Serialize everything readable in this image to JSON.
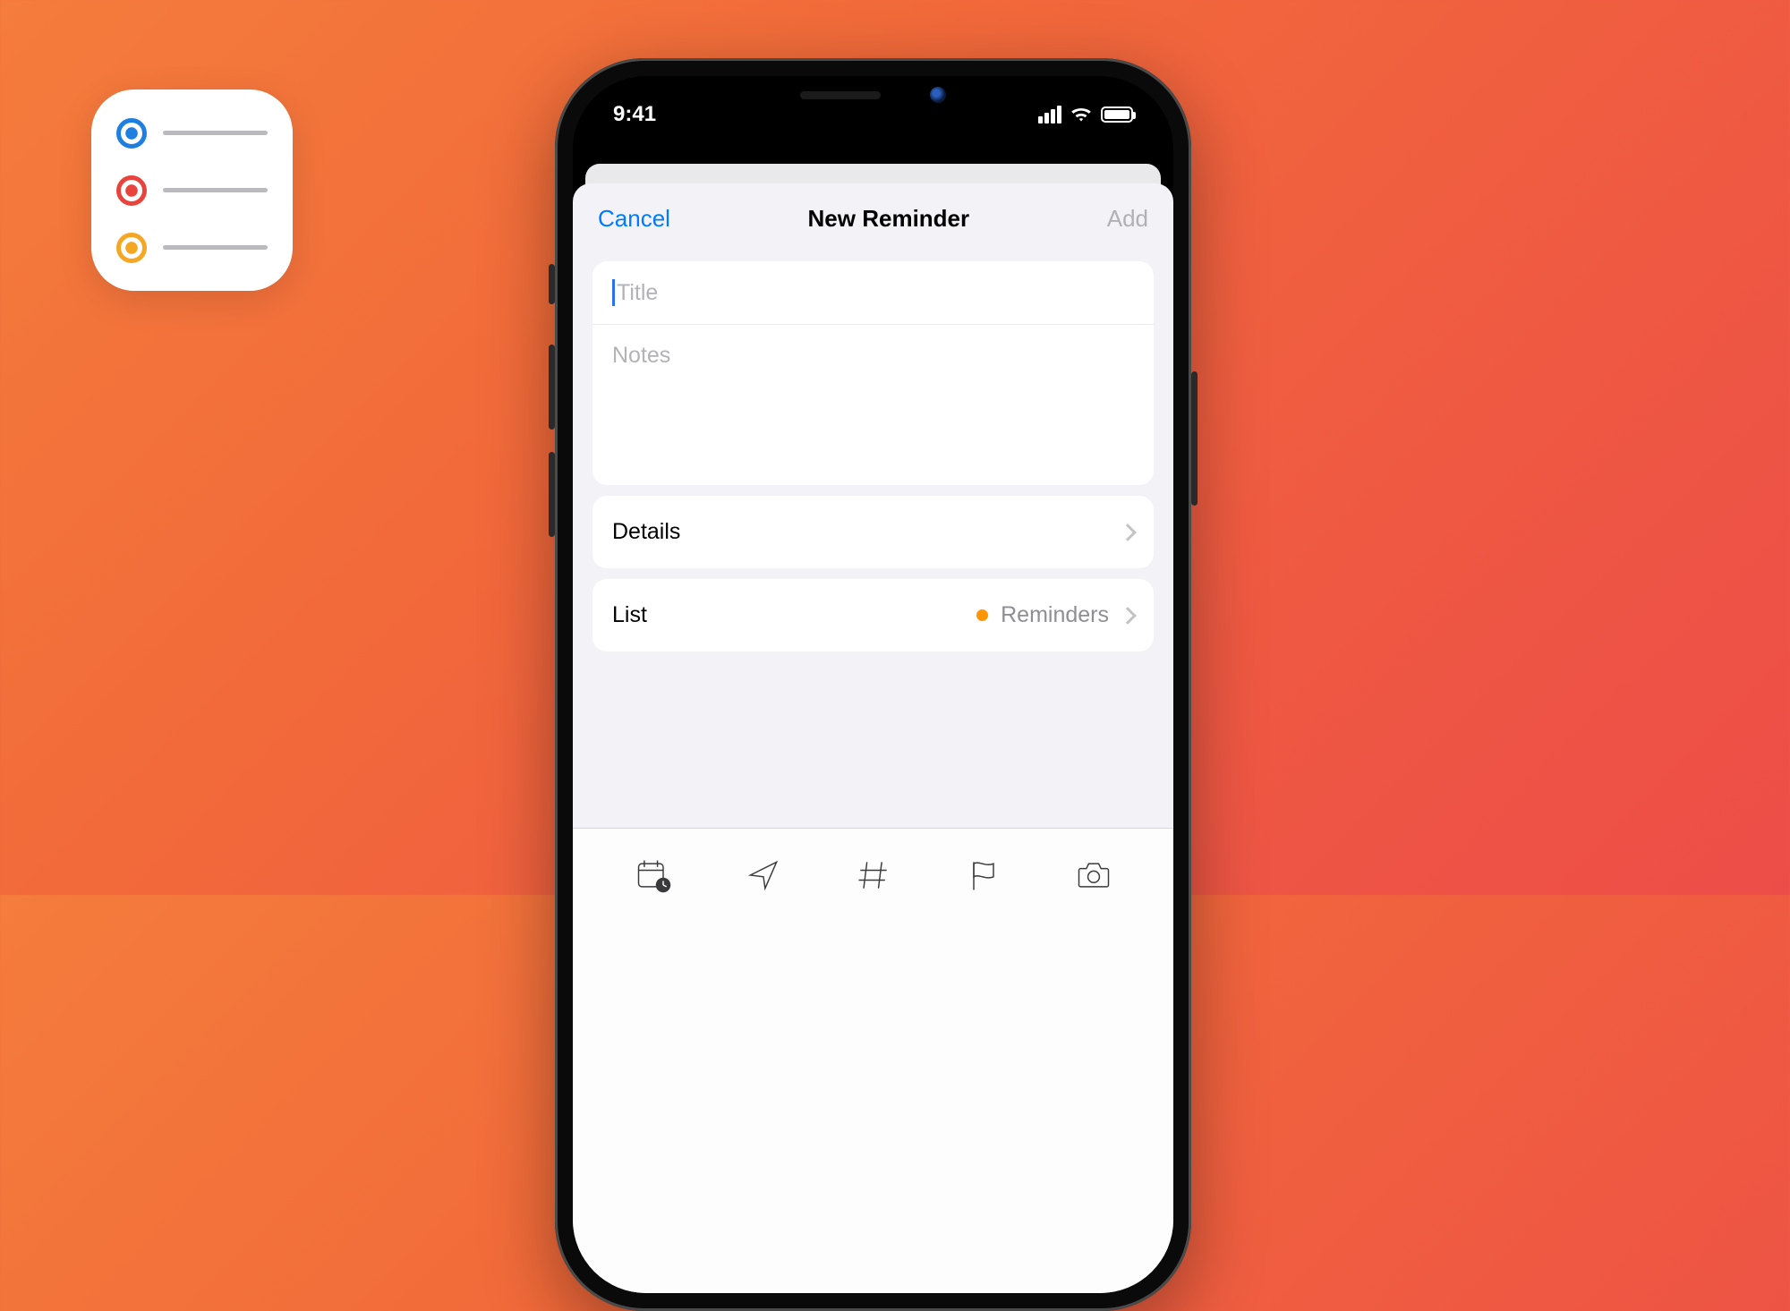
{
  "status": {
    "time": "9:41"
  },
  "nav": {
    "cancel": "Cancel",
    "title": "New Reminder",
    "add": "Add"
  },
  "inputs": {
    "title_placeholder": "Title",
    "notes_placeholder": "Notes"
  },
  "rows": {
    "details": "Details",
    "list_label": "List",
    "list_value": "Reminders"
  },
  "toolbar_icons": {
    "calendar": "calendar-clock-icon",
    "location": "location-arrow-icon",
    "tag": "hashtag-icon",
    "flag": "flag-icon",
    "camera": "camera-icon"
  }
}
